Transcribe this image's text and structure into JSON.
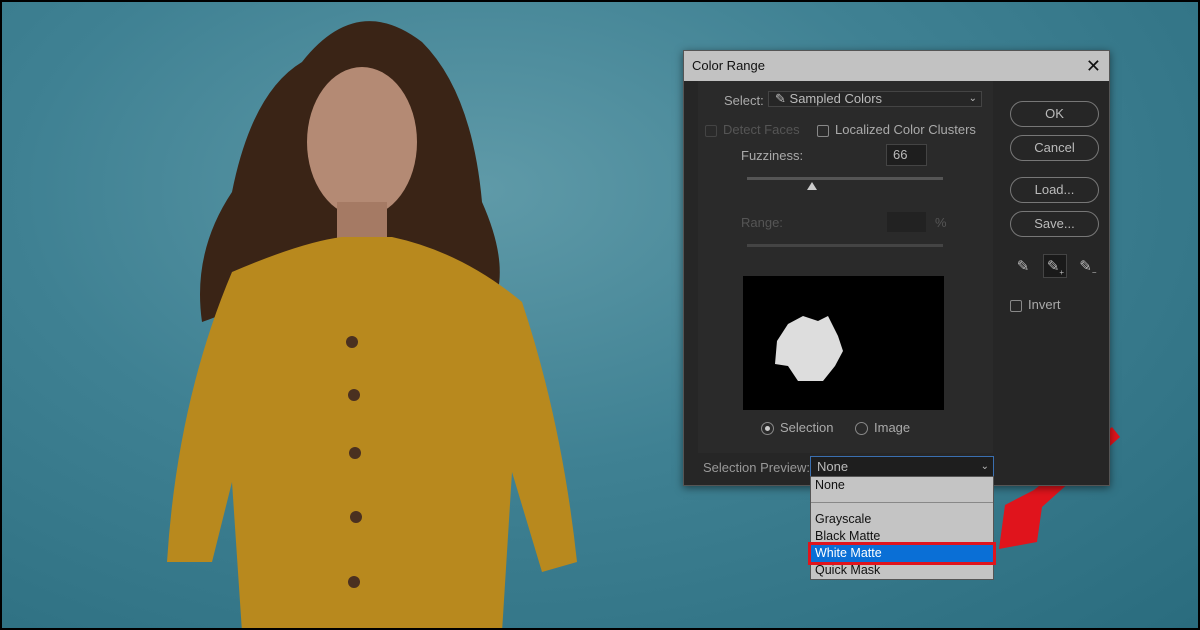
{
  "dialog": {
    "title": "Color Range",
    "select_label": "Select:",
    "select_value": "Sampled Colors",
    "detect_faces": "Detect Faces",
    "localized": "Localized Color Clusters",
    "fuzziness_label": "Fuzziness:",
    "fuzziness_value": "66",
    "fuzziness_fraction": 0.33,
    "range_label": "Range:",
    "range_unit": "%",
    "radio_selection": "Selection",
    "radio_image": "Image",
    "preview_label": "Selection Preview:",
    "preview_value": "None",
    "buttons": {
      "ok": "OK",
      "cancel": "Cancel",
      "load": "Load...",
      "save": "Save..."
    },
    "invert": "Invert",
    "tools": [
      "eyedropper-icon",
      "eyedropper-plus-icon",
      "eyedropper-minus-icon"
    ]
  },
  "dropdown": {
    "items": [
      "None",
      "Grayscale",
      "Black Matte",
      "White Matte",
      "Quick Mask"
    ],
    "selected": "White Matte"
  },
  "colors": {
    "highlight": "#e0141c",
    "selection": "#0a6fd6",
    "shirt": "#b8891e",
    "background": "#3f8193"
  }
}
